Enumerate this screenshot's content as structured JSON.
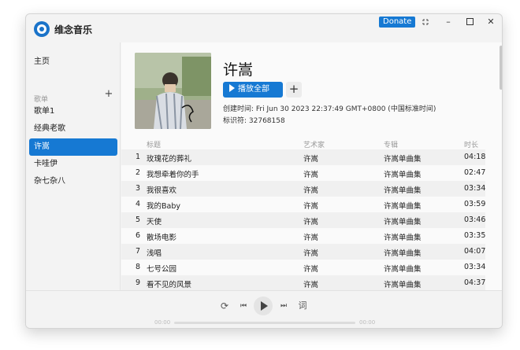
{
  "app": {
    "title": "维念音乐",
    "donate_label": "Donate"
  },
  "window_controls": {
    "pip_icon": "picture-in-picture-icon",
    "min_glyph": "–",
    "max_glyph": "☐",
    "close_glyph": "✕"
  },
  "sidebar": {
    "home_label": "主页",
    "playlists_heading": "歌单",
    "add_glyph": "+",
    "items": [
      {
        "label": "歌单1",
        "active": false
      },
      {
        "label": "经典老歌",
        "active": false
      },
      {
        "label": "许嵩",
        "active": true
      },
      {
        "label": "卡哇伊",
        "active": false
      },
      {
        "label": "杂七杂八",
        "active": false
      }
    ]
  },
  "playlist": {
    "title": "许嵩",
    "play_all_label": "播放全部",
    "add_glyph": "+",
    "created": "创建时间:  Fri Jun 30 2023 22:37:49 GMT+0800 (中国标准时间)",
    "identifier": "标识符:  32768158"
  },
  "table": {
    "headers": {
      "title": "标题",
      "artist": "艺术家",
      "album": "专辑",
      "duration": "时长"
    },
    "rows": [
      {
        "num": "1",
        "title": "玫瑰花的葬礼",
        "artist": "许嵩",
        "album": "许嵩单曲集",
        "duration": "04:18"
      },
      {
        "num": "2",
        "title": "我想牵着你的手",
        "artist": "许嵩",
        "album": "许嵩单曲集",
        "duration": "02:47"
      },
      {
        "num": "3",
        "title": "我很喜欢",
        "artist": "许嵩",
        "album": "许嵩单曲集",
        "duration": "03:34"
      },
      {
        "num": "4",
        "title": "我的Baby",
        "artist": "许嵩",
        "album": "许嵩单曲集",
        "duration": "03:59"
      },
      {
        "num": "5",
        "title": "天使",
        "artist": "许嵩",
        "album": "许嵩单曲集",
        "duration": "03:46"
      },
      {
        "num": "6",
        "title": "散场电影",
        "artist": "许嵩",
        "album": "许嵩单曲集",
        "duration": "03:35"
      },
      {
        "num": "7",
        "title": "浅唱",
        "artist": "许嵩",
        "album": "许嵩单曲集",
        "duration": "04:07"
      },
      {
        "num": "8",
        "title": "七号公园",
        "artist": "许嵩",
        "album": "许嵩单曲集",
        "duration": "03:34"
      },
      {
        "num": "9",
        "title": "看不见的风景",
        "artist": "许嵩",
        "album": "许嵩单曲集",
        "duration": "04:37"
      }
    ]
  },
  "player": {
    "repeat_glyph": "⟳",
    "prev_glyph": "⏮",
    "next_glyph": "⏭",
    "lyrics_label": "词",
    "time_current": "00:00",
    "time_total": "00:00",
    "progress": 0
  },
  "colors": {
    "accent": "#1679d3",
    "window_bg": "#f3f3f3",
    "content_bg": "#fafafa"
  }
}
